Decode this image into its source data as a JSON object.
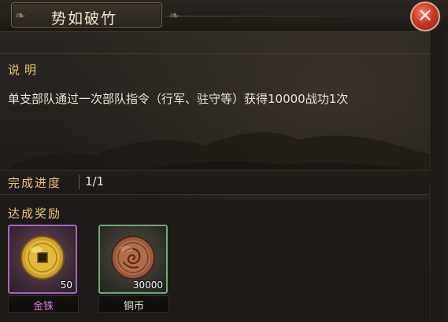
{
  "window": {
    "title": "势如破竹",
    "close_glyph": "✕"
  },
  "description": {
    "header": "说明",
    "text": "单支部队通过一次部队指令（行军、驻守等）获得10000战功1次"
  },
  "progress": {
    "label": "完成进度",
    "value": "1/1"
  },
  "rewards": {
    "header": "达成奖励",
    "items": [
      {
        "name": "金铢",
        "count": "50",
        "icon": "gold-coin-icon",
        "frame_color": "#a465c2",
        "name_color": "#d07be6"
      },
      {
        "name": "铜币",
        "count": "30000",
        "icon": "copper-coin-icon",
        "frame_color": "#6fa77a",
        "name_color": "#e9e4da"
      }
    ]
  },
  "colors": {
    "accent_gold": "#e8c77a",
    "text_light": "#e9e4da",
    "close_red": "#d2352a"
  }
}
